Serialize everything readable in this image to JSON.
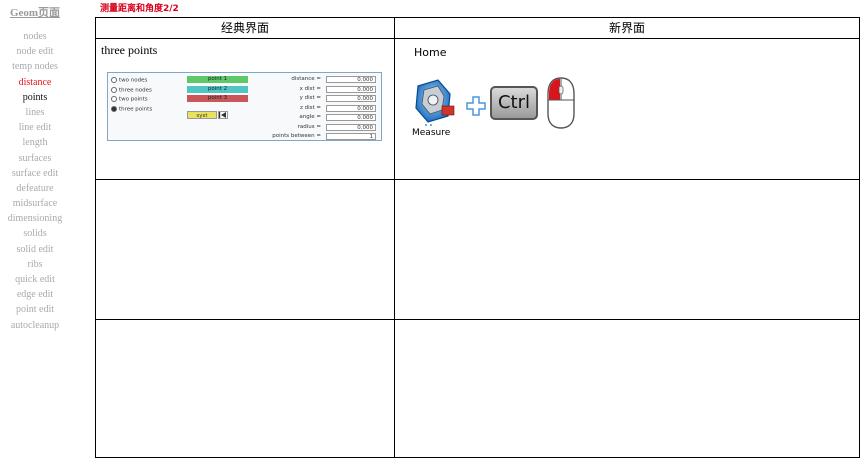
{
  "sidebar": {
    "title": "Geom页面",
    "items": [
      {
        "label": "nodes",
        "state": "normal"
      },
      {
        "label": "node edit",
        "state": "normal"
      },
      {
        "label": "temp nodes",
        "state": "normal"
      },
      {
        "label": "distance",
        "state": "active"
      },
      {
        "label": "points",
        "state": "current"
      },
      {
        "label": "lines",
        "state": "normal"
      },
      {
        "label": "line edit",
        "state": "normal"
      },
      {
        "label": "length",
        "state": "normal"
      },
      {
        "label": "surfaces",
        "state": "normal"
      },
      {
        "label": "surface edit",
        "state": "normal"
      },
      {
        "label": "defeature",
        "state": "normal"
      },
      {
        "label": "midsurface",
        "state": "normal"
      },
      {
        "label": "dimensioning",
        "state": "normal"
      },
      {
        "label": "solids",
        "state": "normal"
      },
      {
        "label": "solid edit",
        "state": "normal"
      },
      {
        "label": "ribs",
        "state": "normal"
      },
      {
        "label": "quick edit",
        "state": "normal"
      },
      {
        "label": "edge edit",
        "state": "normal"
      },
      {
        "label": "point edit",
        "state": "normal"
      },
      {
        "label": "autocleanup",
        "state": "normal"
      }
    ]
  },
  "heading": "测量距离和角度2/2",
  "table": {
    "col_classic": "经典界面",
    "col_new": "新界面",
    "row1_label": "three points"
  },
  "classic_panel": {
    "radios": [
      {
        "label": "two nodes",
        "checked": false
      },
      {
        "label": "three nodes",
        "checked": false
      },
      {
        "label": "two points",
        "checked": false
      },
      {
        "label": "three points",
        "checked": true
      }
    ],
    "point_buttons": [
      {
        "label": "point 1",
        "color": "#5fc86b"
      },
      {
        "label": "point 2",
        "color": "#4fc6c3"
      },
      {
        "label": "point 3",
        "color": "#c9575a"
      }
    ],
    "syst_label": "syst",
    "first_icon": "first-icon",
    "fields": [
      {
        "label": "distance =",
        "value": "0.000"
      },
      {
        "label": "x dist  =",
        "value": "0.000"
      },
      {
        "label": "y dist  =",
        "value": "0.000"
      },
      {
        "label": "z dist  =",
        "value": "0.000"
      },
      {
        "label": "angle  =",
        "value": "0.000"
      },
      {
        "label": "radius  =",
        "value": "0.000"
      },
      {
        "label": "points between =",
        "value": "1"
      }
    ]
  },
  "new_ui": {
    "tab": "Home",
    "tool_label": "Measure",
    "plus": "+",
    "key": "Ctrl",
    "icons": [
      "measure-icon",
      "plus-icon",
      "ctrl-key-icon",
      "mouse-left-click-icon"
    ]
  }
}
